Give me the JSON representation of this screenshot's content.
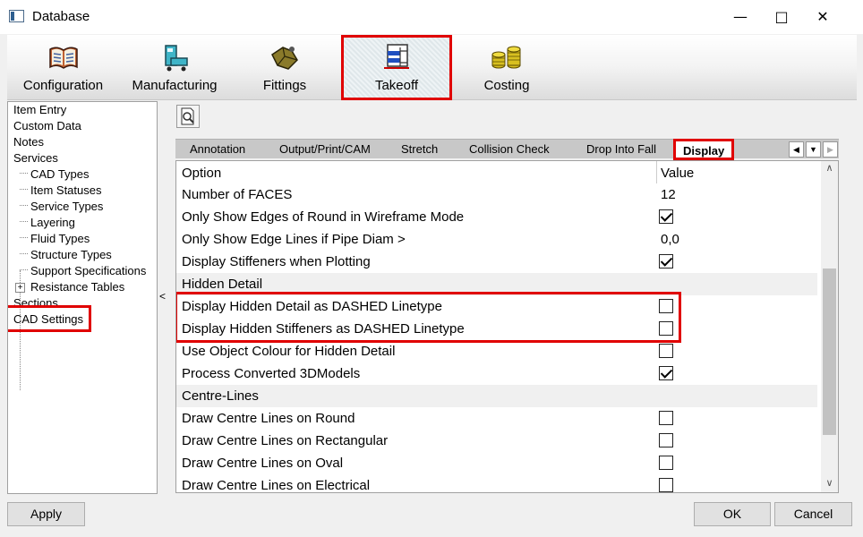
{
  "window": {
    "title": "Database"
  },
  "toolbar": {
    "items": [
      {
        "label": "Configuration",
        "icon": "book-icon"
      },
      {
        "label": "Manufacturing",
        "icon": "machine-icon"
      },
      {
        "label": "Fittings",
        "icon": "fitting-icon"
      },
      {
        "label": "Takeoff",
        "icon": "takeoff-icon",
        "active": true
      },
      {
        "label": "Costing",
        "icon": "coins-icon"
      }
    ]
  },
  "tree": {
    "items": [
      "Item Entry",
      "Custom Data",
      "Notes",
      "Services",
      "CAD Types",
      "Item Statuses",
      "Service Types",
      "Layering",
      "Fluid Types",
      "Structure Types",
      "Support Specifications",
      "Resistance Tables",
      "Sections",
      "CAD Settings"
    ],
    "selected": "CAD Settings"
  },
  "splitter": {
    "arrow": "<"
  },
  "tabs": {
    "items": [
      "Annotation",
      "Output/Print/CAM",
      "Stretch",
      "Collision Check",
      "Drop Into Fall",
      "Display"
    ],
    "active": "Display"
  },
  "grid": {
    "headers": {
      "option": "Option",
      "value": "Value"
    },
    "rows": [
      {
        "type": "value",
        "option": "Number of FACES",
        "value": "12"
      },
      {
        "type": "check",
        "option": "Only Show Edges of Round in Wireframe Mode",
        "checked": true
      },
      {
        "type": "value",
        "option": "Only Show Edge Lines if Pipe Diam >",
        "value": "0,0"
      },
      {
        "type": "check",
        "option": "Display Stiffeners when Plotting",
        "checked": true
      },
      {
        "type": "section",
        "option": "Hidden Detail"
      },
      {
        "type": "check",
        "option": "Display Hidden Detail as DASHED Linetype",
        "checked": false
      },
      {
        "type": "check",
        "option": "Display Hidden Stiffeners as DASHED Linetype",
        "checked": false
      },
      {
        "type": "check",
        "option": "Use Object Colour for Hidden Detail",
        "checked": false
      },
      {
        "type": "check",
        "option": "Process Converted 3DModels",
        "checked": true
      },
      {
        "type": "section",
        "option": "Centre-Lines"
      },
      {
        "type": "check",
        "option": "Draw Centre Lines on Round",
        "checked": false
      },
      {
        "type": "check",
        "option": "Draw Centre Lines on Rectangular",
        "checked": false
      },
      {
        "type": "check",
        "option": "Draw Centre Lines on Oval",
        "checked": false
      },
      {
        "type": "check",
        "option": "Draw Centre Lines on Electrical",
        "checked": false
      }
    ]
  },
  "buttons": {
    "apply": "Apply",
    "ok": "OK",
    "cancel": "Cancel"
  },
  "colors": {
    "highlight": "#e00000",
    "section_bg": "#f0f0f0",
    "tab_strip": "#c8c8c8"
  }
}
